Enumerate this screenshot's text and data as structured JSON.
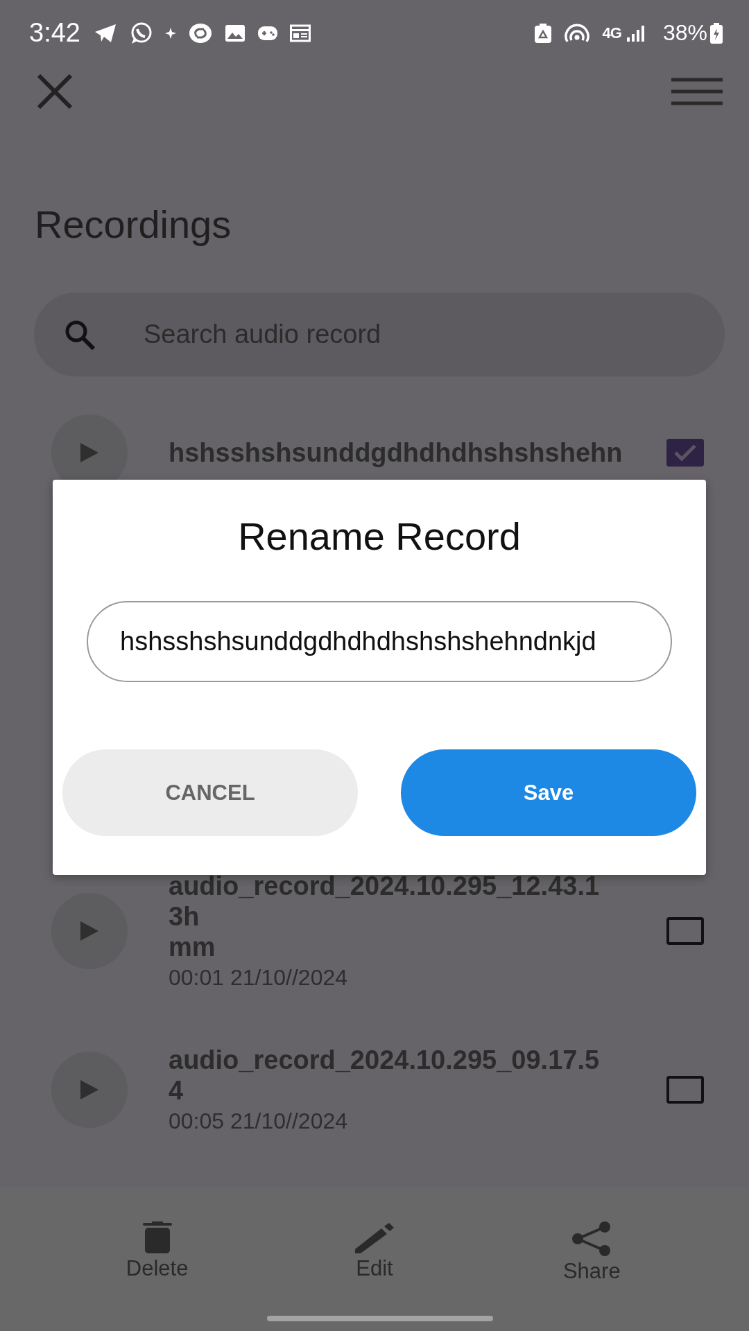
{
  "status_bar": {
    "time": "3:42",
    "network": "4G",
    "battery": "38%"
  },
  "header": {
    "title": "Recordings"
  },
  "search": {
    "placeholder": "Search audio record"
  },
  "recordings": [
    {
      "title_lines": [
        "hshsshshsunddgdhdhdhshshshehn"
      ],
      "checked": true
    },
    {
      "title_lines": [
        "audio_record_2024.10.295_12.43.1",
        "3h",
        "mm"
      ],
      "meta": "00:01 21/10//2024",
      "checked": false
    },
    {
      "title_lines": [
        "audio_record_2024.10.295_09.17.5",
        "4"
      ],
      "meta": "00:05 21/10//2024",
      "checked": false
    }
  ],
  "dialog": {
    "title": "Rename Record",
    "value": "hshsshshsunddgdhdhdhshshshehndnkjd",
    "buttons": [
      {
        "label": "CANCEL",
        "kind": "cancel"
      },
      {
        "label": "Save",
        "kind": "primary"
      }
    ]
  },
  "bottom_actions": [
    {
      "label": "Delete"
    },
    {
      "label": "Edit"
    },
    {
      "label": "Share"
    }
  ]
}
